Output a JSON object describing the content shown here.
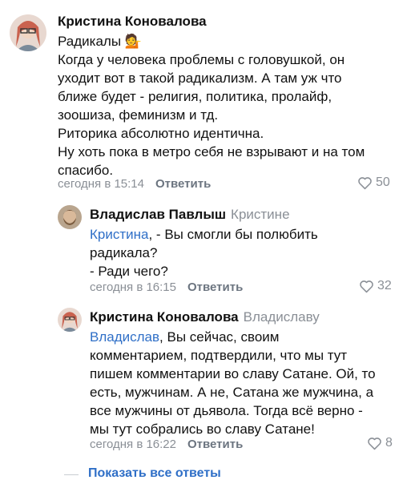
{
  "comments": [
    {
      "author": "Кристина Коновалова",
      "reply_to": "",
      "lines": [
        "Радикалы 💁",
        "Когда у человека проблемы с головушкой, он",
        "уходит вот в такой радикализм. А там уж что",
        "ближе будет - религия, политика, пролайф,",
        "зоошиза, феминизм и тд.",
        "Риторика абсолютно идентична.",
        "Ну хоть пока в метро себя не взрывают и на том",
        "спасибо."
      ],
      "time": "сегодня в 15:14",
      "reply_label": "Ответить",
      "likes": "50"
    },
    {
      "author": "Владислав Павлыш",
      "reply_to": "Кристине",
      "mention": "Кристина",
      "lines": [
        ", - Вы смогли бы полюбить",
        "радикала?",
        "- Ради чего?"
      ],
      "time": "сегодня в 16:15",
      "reply_label": "Ответить",
      "likes": "32"
    },
    {
      "author": "Кристина Коновалова",
      "reply_to": "Владиславу",
      "mention": "Владислав",
      "lines": [
        ", Вы сейчас, своим",
        "комментарием, подтвердили, что мы тут",
        "пишем комментарии во славу Сатане. Ой, то",
        "есть, мужчинам. А не, Сатана же мужчина, а",
        "все мужчины от дьявола. Тогда всё верно -",
        "мы тут собрались во славу Сатане!"
      ],
      "time": "сегодня в 16:22",
      "reply_label": "Ответить",
      "likes": "8"
    }
  ],
  "show_all_label": "Показать все ответы",
  "colors": {
    "link": "#2f6fc7",
    "muted": "#8a8f96"
  }
}
